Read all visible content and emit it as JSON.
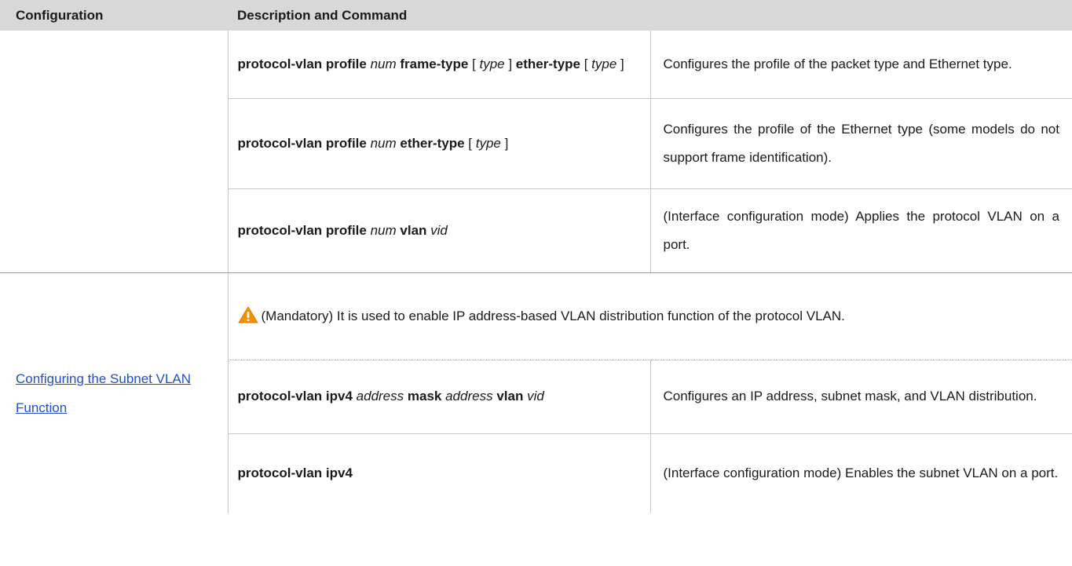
{
  "header": {
    "configuration": "Configuration",
    "description_and_command": "Description and Command"
  },
  "section_protocol": {
    "rows": [
      {
        "cmd": [
          {
            "t": "protocol-vlan profile",
            "s": "kw"
          },
          {
            "t": " ",
            "s": ""
          },
          {
            "t": "num",
            "s": "arg"
          },
          {
            "t": " ",
            "s": ""
          },
          {
            "t": "frame-type",
            "s": "kw"
          },
          {
            "t": " [ ",
            "s": ""
          },
          {
            "t": "type",
            "s": "arg"
          },
          {
            "t": " ] ",
            "s": ""
          },
          {
            "t": "ether-type",
            "s": "kw"
          },
          {
            "t": " [ ",
            "s": ""
          },
          {
            "t": "type",
            "s": "arg"
          },
          {
            "t": " ]",
            "s": ""
          }
        ],
        "desc": "Configures the profile of the packet type and Ethernet type."
      },
      {
        "cmd": [
          {
            "t": "protocol-vlan profile",
            "s": "kw"
          },
          {
            "t": " ",
            "s": ""
          },
          {
            "t": "num",
            "s": "arg"
          },
          {
            "t": " ",
            "s": ""
          },
          {
            "t": "ether-type",
            "s": "kw"
          },
          {
            "t": " [ ",
            "s": ""
          },
          {
            "t": "type",
            "s": "arg"
          },
          {
            "t": " ]",
            "s": ""
          }
        ],
        "desc": "Configures the profile of the Ethernet type (some models do not support frame identification)."
      },
      {
        "cmd": [
          {
            "t": "protocol-vlan profile",
            "s": "kw"
          },
          {
            "t": " ",
            "s": ""
          },
          {
            "t": "num",
            "s": "arg"
          },
          {
            "t": " ",
            "s": ""
          },
          {
            "t": "vlan",
            "s": "kw"
          },
          {
            "t": " ",
            "s": ""
          },
          {
            "t": "vid",
            "s": "arg"
          }
        ],
        "desc": "(Interface configuration mode) Applies the protocol VLAN on a port."
      }
    ]
  },
  "section_subnet": {
    "link_label": "Configuring the Subnet VLAN Function",
    "note_icon": "warning-triangle-icon",
    "note_icon_color": "#f29100",
    "note_text": "(Mandatory) It is used to enable IP address-based VLAN distribution function of the protocol VLAN.",
    "rows": [
      {
        "cmd": [
          {
            "t": "protocol-vlan ipv4",
            "s": "kw"
          },
          {
            "t": " ",
            "s": ""
          },
          {
            "t": "address",
            "s": "arg"
          },
          {
            "t": " ",
            "s": ""
          },
          {
            "t": "mask",
            "s": "kw"
          },
          {
            "t": " ",
            "s": ""
          },
          {
            "t": "address",
            "s": "arg"
          },
          {
            "t": " ",
            "s": ""
          },
          {
            "t": "vlan",
            "s": "kw"
          },
          {
            "t": " ",
            "s": ""
          },
          {
            "t": "vid",
            "s": "arg"
          }
        ],
        "desc": "Configures an IP address, subnet mask, and VLAN distribution."
      },
      {
        "cmd": [
          {
            "t": "protocol-vlan ipv4",
            "s": "kw"
          }
        ],
        "desc": "(Interface configuration mode) Enables the subnet VLAN on a port."
      }
    ]
  }
}
